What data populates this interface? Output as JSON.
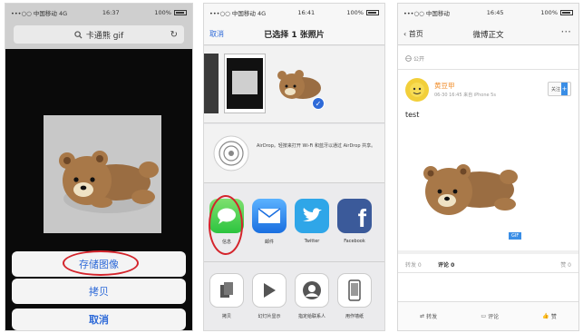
{
  "screen1": {
    "status": {
      "carrier": "•••○○ 中国移动 4G",
      "time": "16:37",
      "battery": "100%"
    },
    "url": "卡通熊 gif",
    "actions": {
      "save_image": "存储图像",
      "copy": "拷贝",
      "cancel": "取消"
    }
  },
  "screen2": {
    "status": {
      "carrier": "•••○○ 中国移动 4G",
      "time": "16:41",
      "battery": "100%"
    },
    "cancel": "取消",
    "title": "已选择 1 张照片",
    "airdrop": "AirDrop。轻按来打开 Wi-Fi 和蓝牙以通过 AirDrop 共享。",
    "share_apps": [
      {
        "label": "信息",
        "icon": "messages-icon"
      },
      {
        "label": "邮件",
        "icon": "mail-icon"
      },
      {
        "label": "Twitter",
        "icon": "twitter-icon"
      },
      {
        "label": "Facebook",
        "icon": "facebook-icon"
      }
    ],
    "action_items": [
      {
        "label": "拷贝",
        "icon": "copy-icon"
      },
      {
        "label": "幻灯片显示",
        "icon": "play-icon"
      },
      {
        "label": "指定给联系人",
        "icon": "contact-icon"
      },
      {
        "label": "用作墙纸",
        "icon": "wallpaper-icon"
      }
    ]
  },
  "screen3": {
    "status": {
      "carrier": "•••○○ 中国移动",
      "time": "16:45",
      "battery": "100%"
    },
    "back": "首页",
    "title": "微博正文",
    "visibility": "公开",
    "author": "黄豆甲",
    "meta": "06-30 16:45  来自 iPhone 5s",
    "follow": "关注",
    "post_text": "test",
    "gif_badge": "GIF",
    "tabs": {
      "repost": "转发 0",
      "comment": "评论 0",
      "like": "赞 0"
    },
    "toolbar": {
      "repost": "转发",
      "comment": "评论",
      "like": "赞"
    }
  },
  "colors": {
    "ios_blue": "#2e6ad8",
    "highlight_red": "#d4242b",
    "weibo_orange": "#f08a24"
  }
}
